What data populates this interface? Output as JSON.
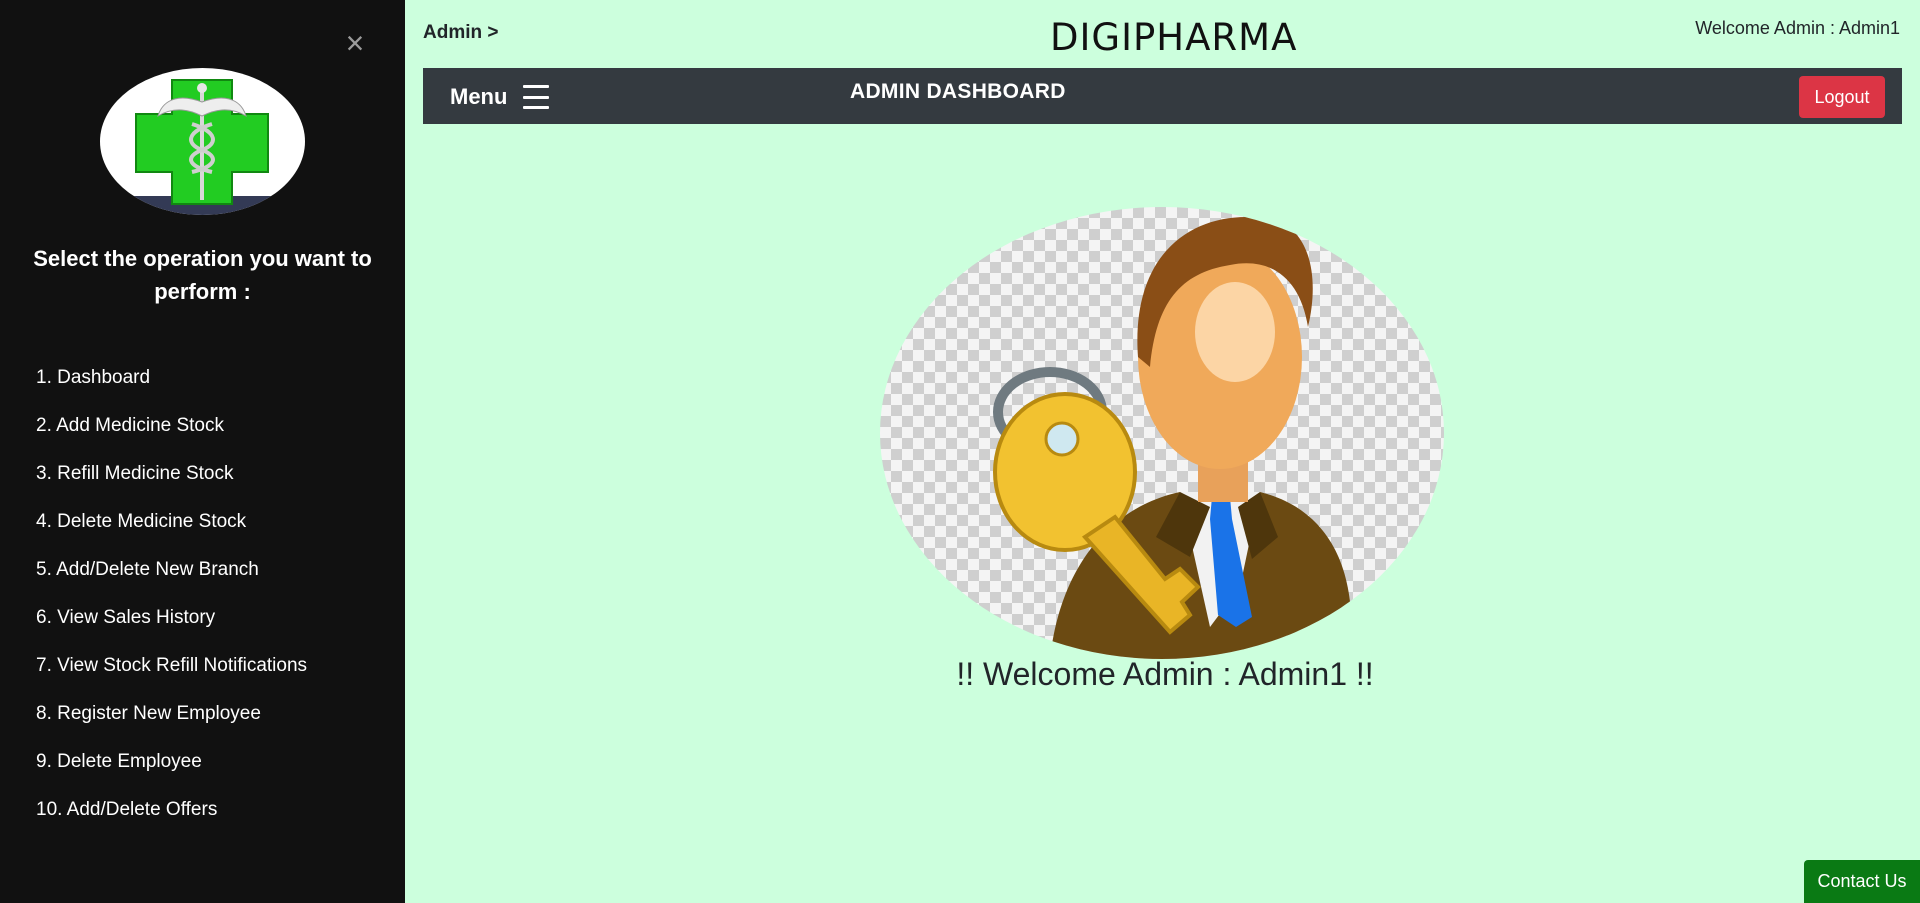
{
  "app": {
    "brand": "DIGIPHARMA",
    "breadcrumb": "Admin >",
    "welcome_top": "Welcome Admin : Admin1"
  },
  "sidebar": {
    "close_glyph": "×",
    "logo_icon": "caduceus-green-cross-icon",
    "heading": "Select the operation you want to perform :",
    "items": [
      {
        "label": "1. Dashboard"
      },
      {
        "label": "2. Add Medicine Stock"
      },
      {
        "label": "3. Refill Medicine Stock"
      },
      {
        "label": "4. Delete Medicine Stock"
      },
      {
        "label": "5. Add/Delete New Branch"
      },
      {
        "label": "6. View Sales History"
      },
      {
        "label": "7. View Stock Refill Notifications"
      },
      {
        "label": "8. Register New Employee"
      },
      {
        "label": "9. Delete Employee"
      },
      {
        "label": "10. Add/Delete Offers"
      }
    ]
  },
  "navbar": {
    "menu_label": "Menu",
    "title": "ADMIN DASHBOARD",
    "logout_label": "Logout"
  },
  "main": {
    "image_icon": "admin-key-icon",
    "welcome_message": "!! Welcome Admin : Admin1 !!"
  },
  "footer": {
    "contact_label": "Contact Us"
  },
  "colors": {
    "page_bg": "#ccffdd",
    "sidebar_bg": "#111111",
    "navbar_bg": "#343a40",
    "logout_bg": "#dc3545",
    "contact_bg": "#0a7a14",
    "cross_green": "#22cc22"
  }
}
